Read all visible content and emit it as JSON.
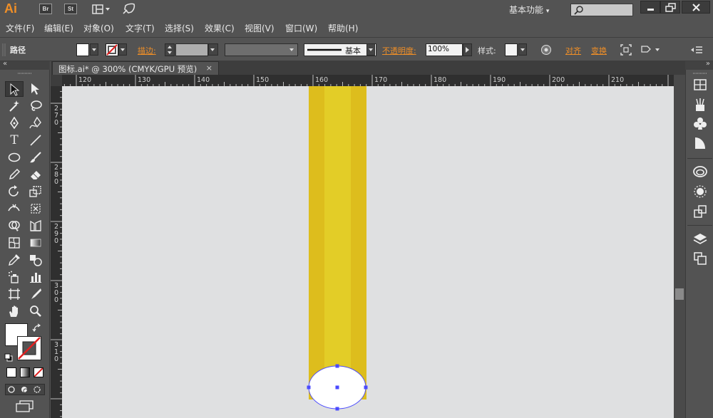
{
  "app": {
    "logo": "Ai",
    "bridge_badge": "Br",
    "stock_badge": "St",
    "workspace_label": "基本功能"
  },
  "menu": [
    "文件(F)",
    "编辑(E)",
    "对象(O)",
    "文字(T)",
    "选择(S)",
    "效果(C)",
    "视图(V)",
    "窗口(W)",
    "帮助(H)"
  ],
  "control": {
    "selection_type": "路径",
    "stroke_label": "描边:",
    "brush_profile": "基本",
    "opacity_label": "不透明度:",
    "opacity_value": "100%",
    "style_label": "样式:",
    "align_label": "对齐",
    "transform_label": "变换"
  },
  "document": {
    "tab_title": "图标.ai* @ 300% (CMYK/GPU 预览)",
    "close_symbol": "×"
  },
  "rulers": {
    "h_labels": [
      "120",
      "130",
      "140",
      "150",
      "160",
      "170",
      "180",
      "190",
      "200",
      "210"
    ],
    "v_labels": [
      "270",
      "280",
      "290",
      "300",
      "310"
    ]
  },
  "colors": {
    "accent": "#f08f27",
    "ui_bg": "#535353",
    "canvas_bg": "#dfe0e1",
    "pencil_dark": "#ddbd1d",
    "pencil_light": "#e3cd27",
    "selection": "#4b4bff"
  },
  "icons": {
    "fill_swatch": "white-fill-swatch",
    "stroke_swatch": "none-stroke-swatch"
  }
}
